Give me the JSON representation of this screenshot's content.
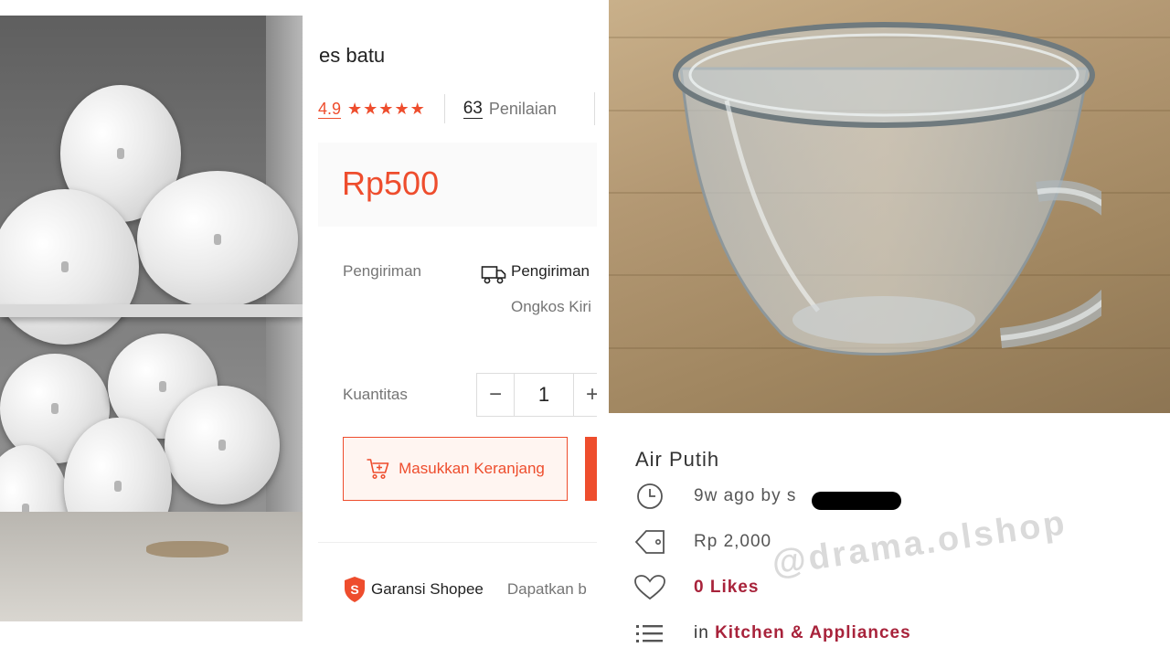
{
  "shopee": {
    "product_title": "es batu",
    "rating": "4.9",
    "stars": "★★★★★",
    "ratings_count": "63",
    "ratings_label": "Penilaian",
    "price": "Rp500",
    "shipping_label": "Pengiriman",
    "shipping_value": "Pengiriman",
    "shipping_fee_label": "Ongkos Kiri",
    "quantity_label": "Kuantitas",
    "quantity_minus": "−",
    "quantity_value": "1",
    "quantity_plus": "+",
    "add_to_cart_label": "Masukkan Keranjang",
    "guarantee_label": "Garansi Shopee",
    "guarantee_sub": "Dapatkan b",
    "accent_color": "#ee4d2d"
  },
  "listing": {
    "title": "Air Putih",
    "posted": "9w ago by s",
    "price": "Rp 2,000",
    "likes_count": "0",
    "likes_label": "Likes",
    "category_prefix": "in",
    "category": "Kitchen & Appliances",
    "accent_color": "#a8233b"
  },
  "watermark": "@drama.olshop",
  "icons": {
    "clock": "clock-icon",
    "price_tag": "price-tag-icon",
    "heart": "heart-icon",
    "list": "list-icon",
    "truck": "truck-icon",
    "cart": "cart-icon",
    "shield": "shield-icon",
    "star": "star-icon"
  }
}
